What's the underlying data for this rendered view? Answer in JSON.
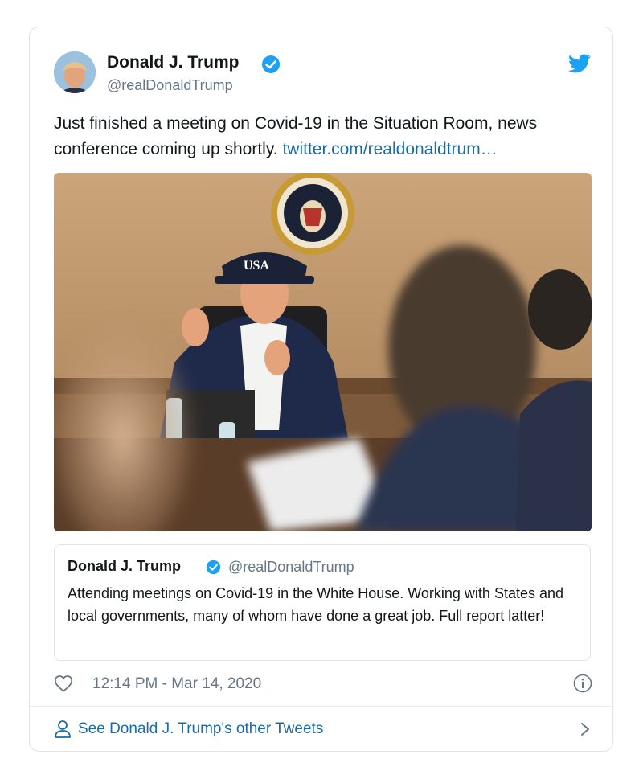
{
  "tweet": {
    "author_name": "Donald J. Trump",
    "handle": "@realDonaldTrump",
    "text": "Just finished a meeting on Covid-19 in the Situation Room, news conference coming up shortly. ",
    "link_text": "twitter.com/realdonaldtrum…",
    "photo": {
      "cap_text": "USA"
    }
  },
  "quoted_tweet": {
    "author_name": "Donald J. Trump",
    "handle": "@realDonaldTrump",
    "text": "Attending meetings on Covid-19 in the White House. Working with States and local governments, many of whom have done a great job. Full report latter!"
  },
  "meta": {
    "timestamp": "12:14 PM - Mar 14, 2020"
  },
  "footer": {
    "label": "See Donald J. Trump's other Tweets"
  },
  "icons": {
    "verified": "verified-badge-icon",
    "brand": "twitter-bird-icon",
    "like": "heart-icon",
    "info": "info-icon",
    "profile": "person-icon",
    "more": "chevron-right-icon"
  },
  "colors": {
    "twitter_blue": "#1da1f2",
    "link": "#1b6ba6",
    "secondary_text": "#657786",
    "border": "#dfe3e6"
  }
}
